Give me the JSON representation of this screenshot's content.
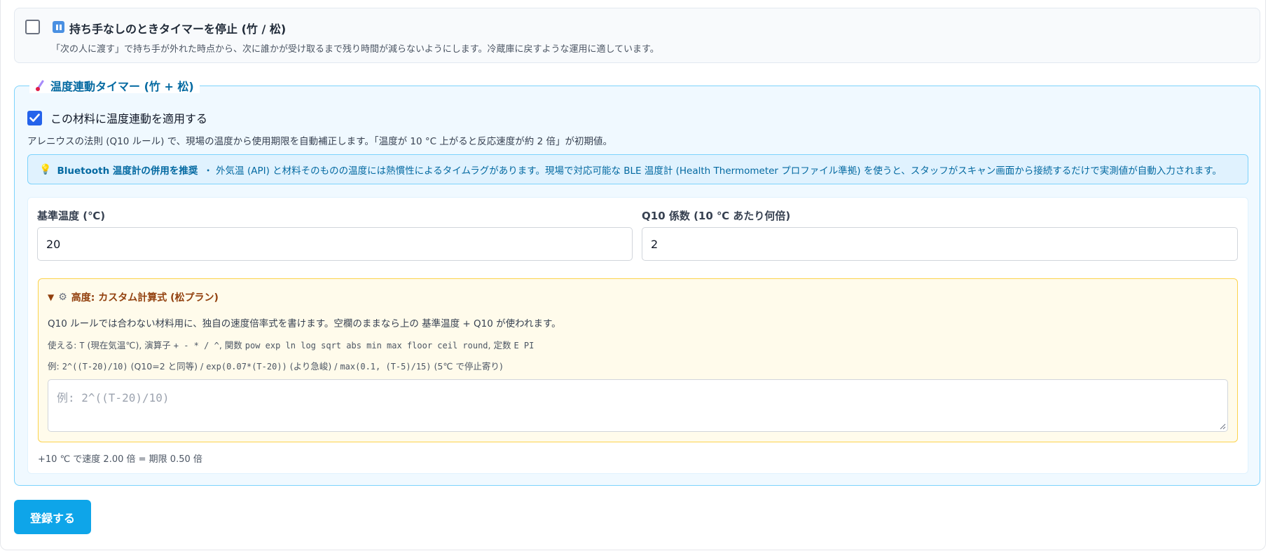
{
  "pause_option": {
    "checked": false,
    "icon": "pause-icon",
    "title": "持ち手なしのときタイマーを停止 (竹 / 松)",
    "description": "「次の人に渡す」で持ち手が外れた時点から、次に誰かが受け取るまで残り時間が減らないようにします。冷蔵庫に戻すような運用に適しています。"
  },
  "temperature": {
    "legend_icon": "thermometer-icon",
    "legend": "温度連動タイマー (竹 + 松)",
    "apply_checked": true,
    "apply_label": "この材料に温度連動を適用する",
    "description": "アレニウスの法則 (Q10 ルール) で、現場の温度から使用期限を自動補正します。「温度が 10 °C 上がると反応速度が約 2 倍」が初期値。",
    "tip": {
      "icon": "lightbulb-icon",
      "strong": "Bluetooth 温度計の併用を推奨",
      "text": "・ 外気温 (API) と材料そのものの温度には熱慣性によるタイムラグがあります。現場で対応可能な BLE 温度計 (Health Thermometer プロファイル準拠) を使うと、スタッフがスキャン画面から接続するだけで実測値が自動入力されます。"
    },
    "base_temp": {
      "label": "基準温度 (℃)",
      "value": "20"
    },
    "q10": {
      "label": "Q10 係数 (10 ℃ あたり何倍)",
      "value": "2"
    },
    "advanced": {
      "expanded": true,
      "summary": "高度: カスタム計算式 (松プラン)",
      "description": "Q10 ルールでは合わない材料用に、独自の速度倍率式を書けます。空欄のままなら上の 基準温度 + Q10 が使われます。",
      "usable_prefix": "使える:",
      "usable_t": "T",
      "usable_t_desc": "(現在気温℃), 演算子",
      "usable_ops": "+ - * / ^",
      "usable_funcs_prefix": ", 関数",
      "usable_funcs": "pow exp ln log sqrt abs min max floor ceil round",
      "usable_consts_prefix": ", 定数",
      "usable_consts": "E PI",
      "examples_prefix": "例:",
      "ex1_code": "2^((T-20)/10)",
      "ex1_note": "(Q10=2 と同等) /",
      "ex2_code": "exp(0.07*(T-20))",
      "ex2_note": "(より急峻) /",
      "ex3_code": "max(0.1, (T-5)/15)",
      "ex3_note": "(5℃ で停止寄り)",
      "formula_placeholder": "例: 2^((T-20)/10)",
      "formula_value": ""
    },
    "result": "+10 ℃ で速度 2.00 倍 = 期限 0.50 倍"
  },
  "submit_label": "登録する",
  "colors": {
    "accent_blue": "#0369a1",
    "submit_bg": "#0ea5e9",
    "checkbox_checked": "#2563eb",
    "advanced_border": "#fcd34d"
  }
}
